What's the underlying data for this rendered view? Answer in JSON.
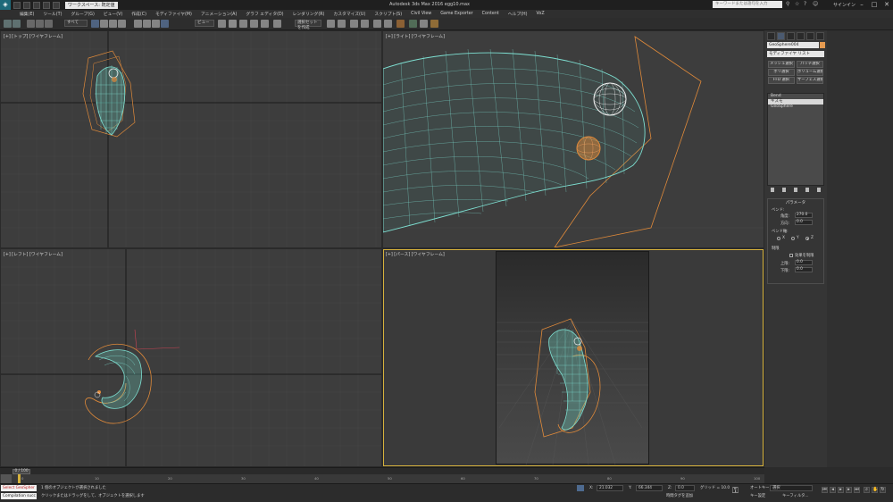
{
  "title_bar": {
    "workspace": "ワークスペース: 既定値",
    "title": "Autodesk 3ds Max 2016    egg10.max",
    "search_placeholder": "キーワードまたは語句を入力",
    "signin": "サインイン"
  },
  "menu": [
    "編集(E)",
    "ツール(T)",
    "グループ(G)",
    "ビュー(V)",
    "作成(C)",
    "モディファイヤ(M)",
    "アニメーション(A)",
    "グラフ エディタ(D)",
    "レンダリング(R)",
    "カスタマイズ(U)",
    "スクリプト(S)",
    "Civil View",
    "Game Exporter",
    "Content",
    "ヘルプ(H)",
    "VoZ"
  ],
  "toolbar": {
    "selection_filter": "すべて",
    "ref_coord": "ビュー",
    "named_selection": "選択セットを作成"
  },
  "viewports": {
    "top": "[+] [トップ] [ワイヤフレーム]",
    "right": "[+] [ライト] [ワイヤフレーム]",
    "left": "[+] [レフト] [ワイヤフレーム]",
    "perspective": "[+] [パース] [ワイヤフレーム]"
  },
  "command_panel": {
    "object_name": "GeoSphere004",
    "modifier_list": "モディファイヤ リスト",
    "buttons": [
      "メッシュ選択",
      "パッチ選択",
      "ポリ選択",
      "ボリューム選択",
      "FFD 選択",
      "サーフェス選択"
    ],
    "stack": [
      "Bend",
      "ギズモ",
      "GeoSphere"
    ],
    "rollout": {
      "title": "パラメータ",
      "bend_group": "ベンド:",
      "angle_label": "角度:",
      "angle_value": "270.0",
      "direction_label": "方向:",
      "direction_value": "0.0",
      "bend_axis": "ベンド軸:",
      "axes": [
        "X",
        "Y",
        "Z"
      ],
      "limit_group": "制限",
      "limit_effect": "効果を制限",
      "upper_label": "上限:",
      "upper_value": "0.0",
      "lower_label": "下限:",
      "lower_value": "0.0"
    }
  },
  "timeline": {
    "frame": "0 / 100",
    "ticks": [
      "0",
      "10",
      "20",
      "30",
      "40",
      "50",
      "60",
      "70",
      "80",
      "90",
      "100"
    ]
  },
  "status": {
    "select_label": "Select GeoSpher",
    "welcome": "Compilation succ",
    "msg1": "1 個のオブジェクトが選択されました",
    "msg2": "クリックまたはドラッグをして、オブジェクトを選択します",
    "x_label": "X:",
    "x_value": "21.032",
    "y_label": "Y:",
    "y_value": "66.344",
    "z_label": "Z:",
    "z_value": "0.0",
    "grid": "グリッド = 10.0",
    "add_time_tag": "時間タグを追加",
    "autokey": "オートキー",
    "autokey_value": "選択",
    "setkey": "キー設定",
    "key_filter": "キーフィルタ..."
  }
}
